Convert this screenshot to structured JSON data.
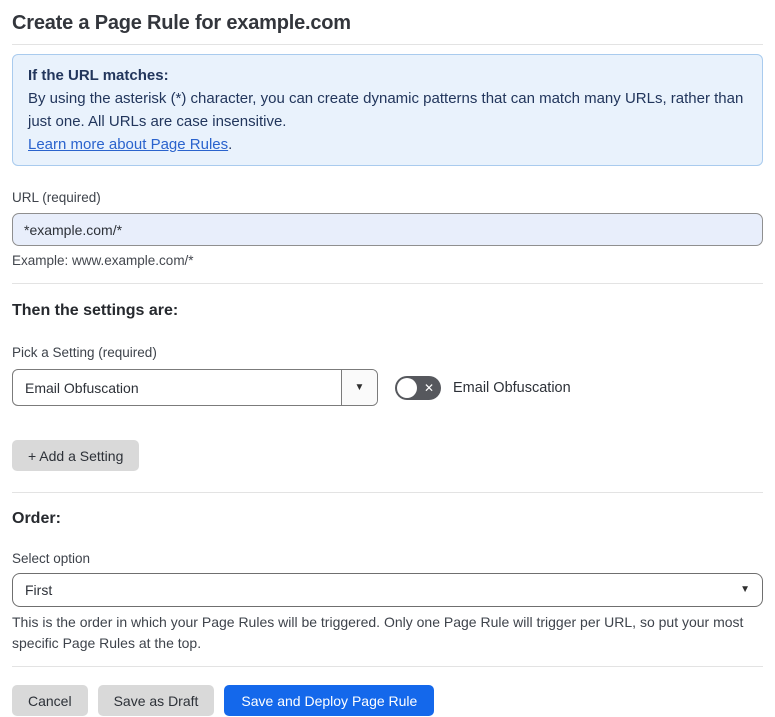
{
  "page": {
    "title": "Create a Page Rule for example.com"
  },
  "info_box": {
    "heading": "If the URL matches:",
    "body": "By using the asterisk (*) character, you can create dynamic patterns that can match many URLs, rather than just one. All URLs are case insensitive.",
    "link_label": "Learn more about Page Rules",
    "link_suffix": "."
  },
  "url_field": {
    "label": "URL (required)",
    "value": "*example.com/*",
    "example": "Example: www.example.com/*"
  },
  "settings_section": {
    "heading": "Then the settings are:",
    "pick_label": "Pick a Setting (required)",
    "selected_setting": "Email Obfuscation",
    "toggle_label": "Email Obfuscation",
    "toggle_state": "off",
    "add_button_label": "+ Add a Setting"
  },
  "order_section": {
    "heading": "Order:",
    "select_label": "Select option",
    "selected_option": "First",
    "help_text": "This is the order in which your Page Rules will be triggered. Only one Page Rule will trigger per URL, so put your most specific Page Rules at the top."
  },
  "footer": {
    "cancel_label": "Cancel",
    "save_draft_label": "Save as Draft",
    "save_deploy_label": "Save and Deploy Page Rule"
  },
  "icons": {
    "chevron_down": "▼",
    "close_x": "✕"
  },
  "colors": {
    "accent_blue": "#1468eb",
    "link_blue": "#2a63cd",
    "info_bg": "#e9f2fc",
    "info_border": "#a9cbee",
    "info_text": "#22365c",
    "input_bg": "#e8eefb",
    "toggle_bg": "#56585d",
    "button_gray": "#d9d9d9"
  }
}
